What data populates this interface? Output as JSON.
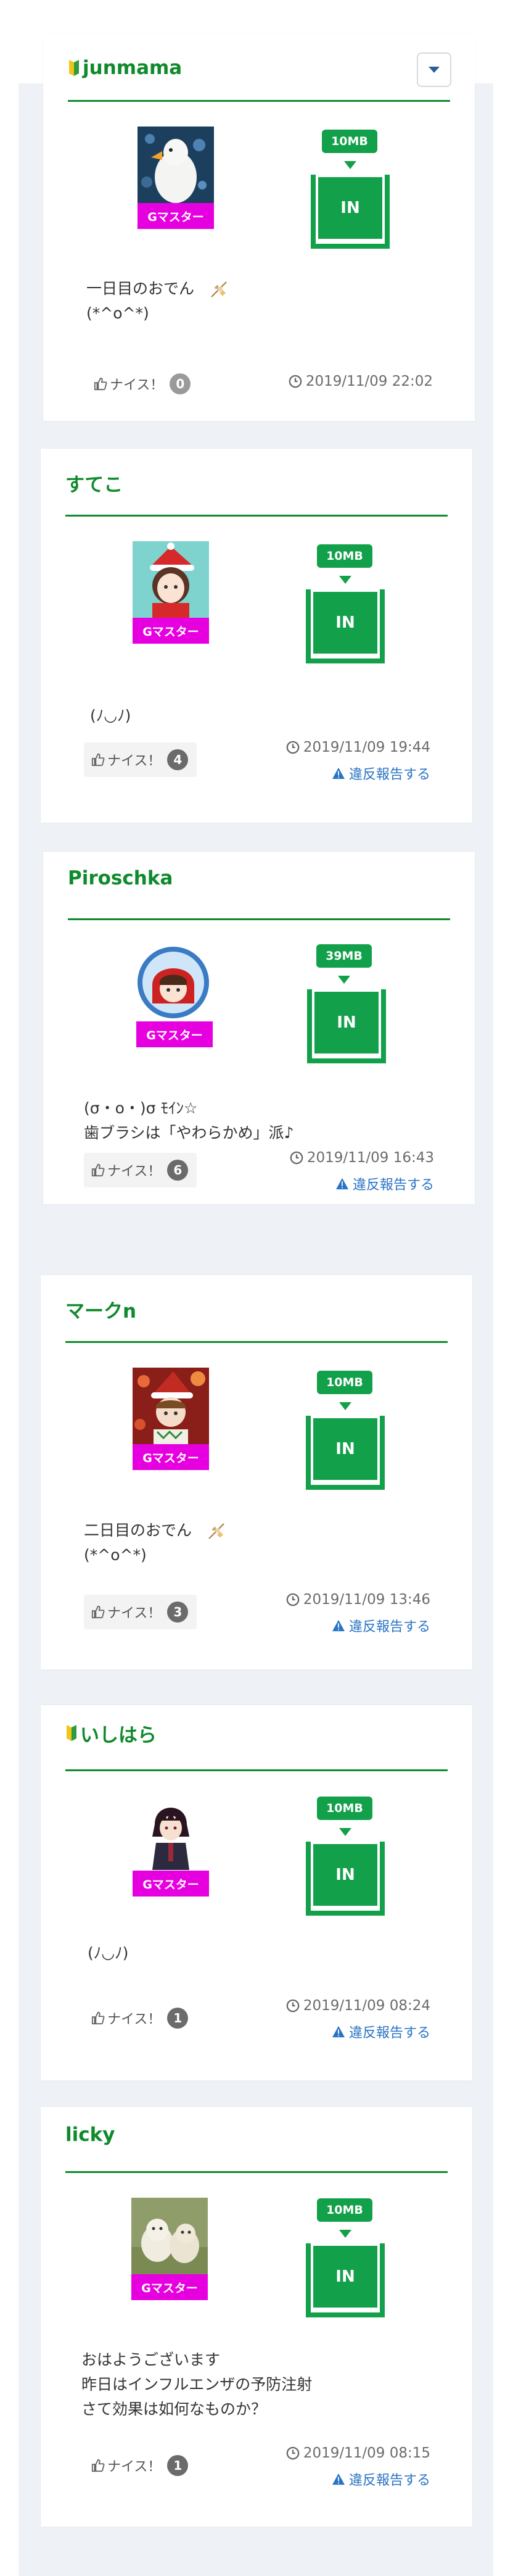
{
  "colors": {
    "brand_green": "#0f8a2c",
    "button_green": "#13a04a",
    "badge_magenta": "#e600e0",
    "link_blue": "#2a74c4",
    "page_background": "#eef1f6"
  },
  "labels": {
    "rank_badge": "Gマスター",
    "in_button": "IN",
    "nice_label": "ナイス！",
    "report_link": "違反報告する"
  },
  "icons": {
    "beginner_mark": "beginner-mark-icon",
    "thumbs_up": "thumbs-up-icon",
    "clock": "clock-icon",
    "warning": "warning-icon",
    "dropdown": "chevron-down-icon",
    "oden": "oden-emoji-icon"
  },
  "posts": [
    {
      "username": "junmama",
      "beginner": true,
      "avatar": "goose-avatar",
      "data_size": "10MB",
      "comment_line1": "一日目のおでん",
      "comment_line2": "(*^o^*)",
      "nice_count": "0",
      "datetime": "2019/11/09 22:02"
    },
    {
      "username": "すてこ",
      "beginner": false,
      "avatar": "santa-girl-avatar",
      "data_size": "10MB",
      "comment_line1": "(ﾉ◡ﾉ)",
      "nice_count": "4",
      "datetime": "2019/11/09 19:44"
    },
    {
      "username": "Piroschka",
      "beginner": false,
      "avatar": "red-hood-avatar",
      "data_size": "39MB",
      "comment_line1": "(σ・o・)σ ﾓｲﾝ☆",
      "comment_line2": "歯ブラシは「やわらかめ」派♪",
      "nice_count": "6",
      "datetime": "2019/11/09 16:43"
    },
    {
      "username": "マークn",
      "beginner": false,
      "avatar": "christmas-boy-avatar",
      "data_size": "10MB",
      "comment_line1": "二日目のおでん",
      "comment_line2": "(*^o^*)",
      "nice_count": "3",
      "datetime": "2019/11/09 13:46"
    },
    {
      "username": "いしはら",
      "beginner": true,
      "avatar": "anime-character-avatar",
      "data_size": "10MB",
      "comment_line1": "(ﾉ◡ﾉ)",
      "nice_count": "1",
      "datetime": "2019/11/09 08:24"
    },
    {
      "username": "licky",
      "beginner": false,
      "avatar": "dogs-avatar",
      "data_size": "10MB",
      "comment_line1": "おはようございます",
      "comment_line2": "昨日はインフルエンザの予防注射",
      "comment_line3": "さて効果は如何なものか？",
      "nice_count": "1",
      "datetime": "2019/11/09 08:15"
    }
  ]
}
